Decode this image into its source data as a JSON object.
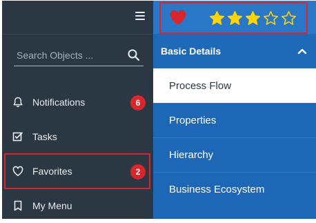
{
  "sidebar": {
    "search": {
      "placeholder": "Search Objects ..."
    },
    "nav": [
      {
        "label": "Notifications",
        "icon": "bell-icon",
        "badge": "6"
      },
      {
        "label": "Tasks",
        "icon": "checkbox-icon"
      },
      {
        "label": "Favorites",
        "icon": "heart-outline-icon",
        "badge": "2"
      },
      {
        "label": "My Menu",
        "icon": "bookmark-icon"
      }
    ]
  },
  "header": {
    "favorite": {
      "icon": "heart-filled-icon",
      "color": "#d8262c"
    },
    "rating": {
      "value": 3,
      "max": 5,
      "color": "#ffd400"
    }
  },
  "panel": {
    "section_title": "Basic Details",
    "items": [
      {
        "label": "Process Flow",
        "active": true
      },
      {
        "label": "Properties"
      },
      {
        "label": "Hierarchy"
      },
      {
        "label": "Business Ecosystem"
      }
    ]
  },
  "colors": {
    "sidebar_bg": "#2b3742",
    "panel_bg": "#1d67b6",
    "accent_red": "#d8262c"
  }
}
